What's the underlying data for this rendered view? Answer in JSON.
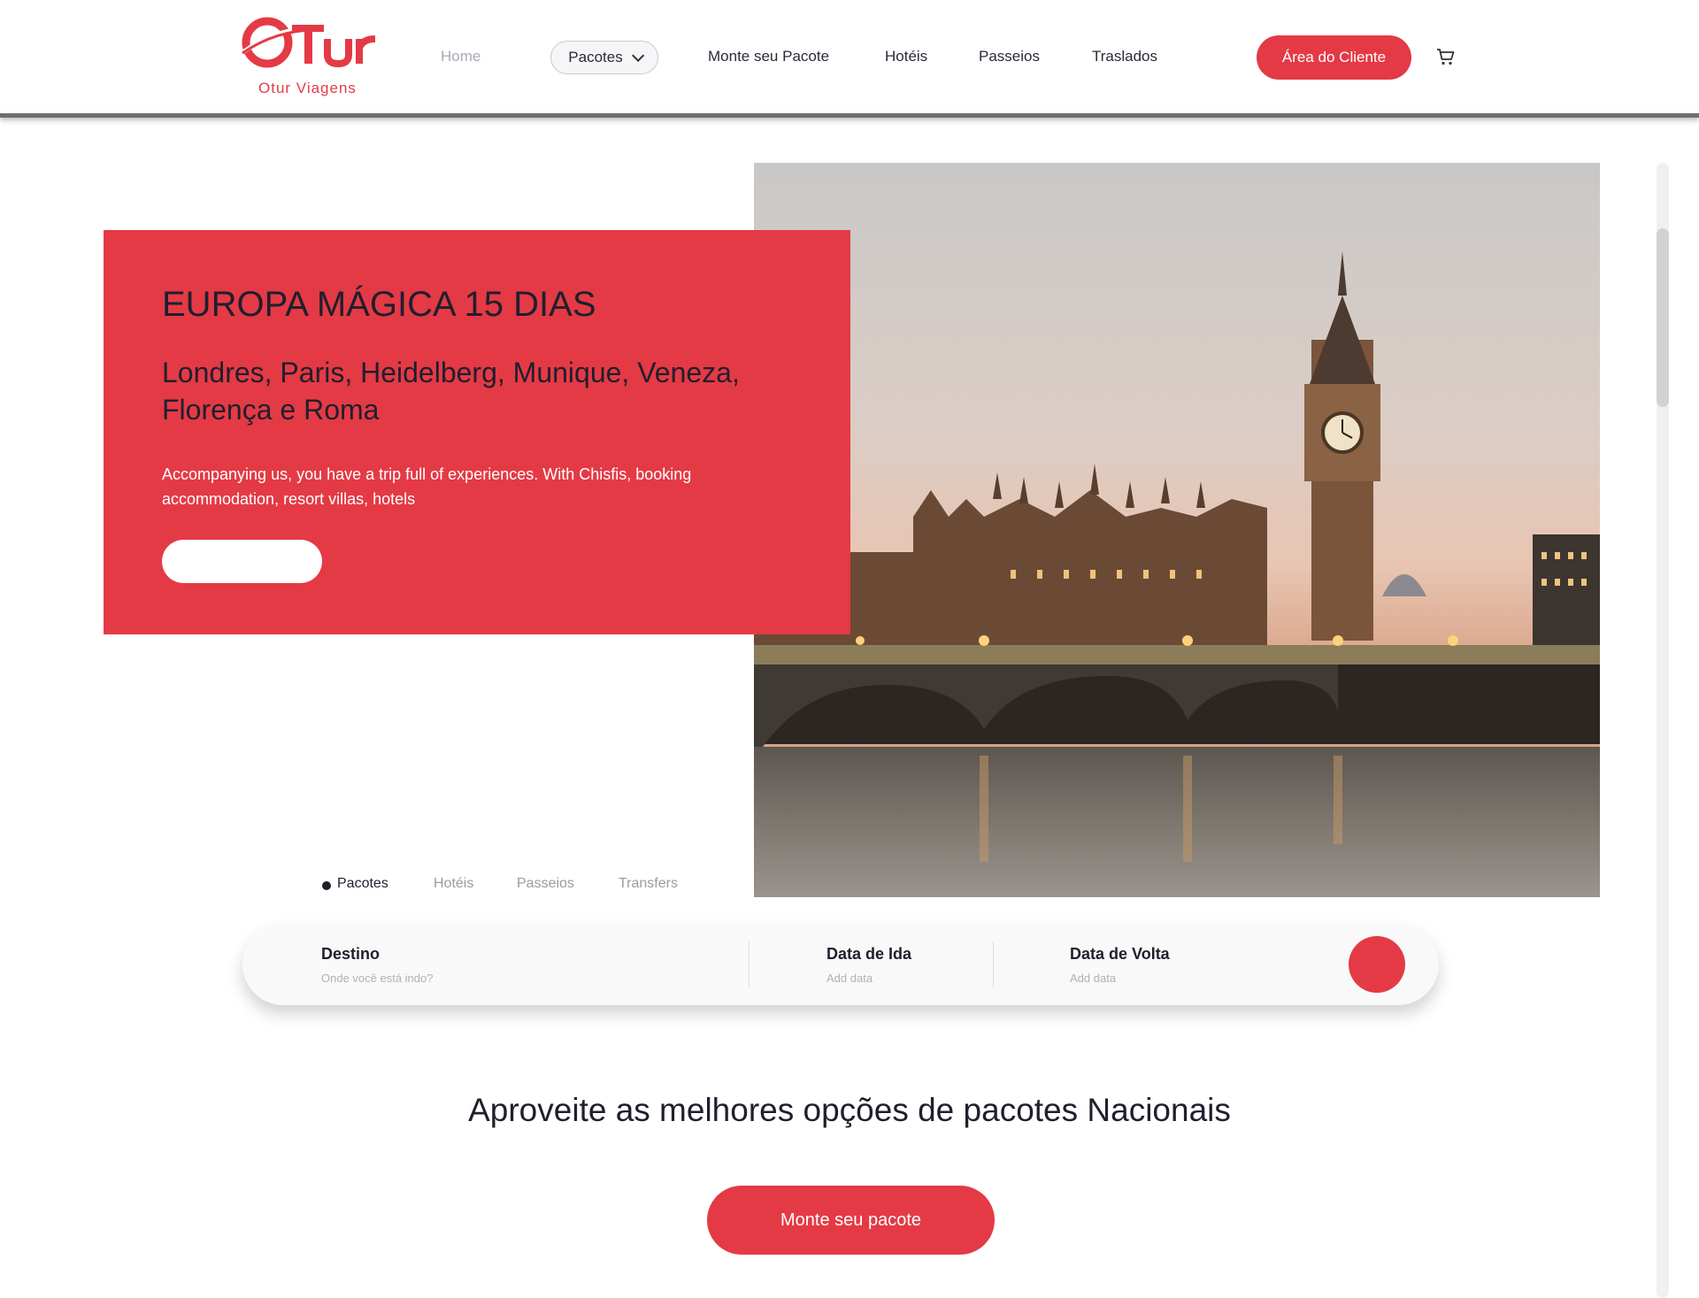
{
  "brand": {
    "logo_text": "Otur",
    "subtitle": "Otur Viagens"
  },
  "nav": {
    "home": "Home",
    "pacotes": "Pacotes",
    "monte": "Monte seu Pacote",
    "hoteis": "Hotéis",
    "passeios": "Passeios",
    "traslados": "Traslados",
    "cliente_button": "Área do Cliente"
  },
  "hero": {
    "title": "EUROPA MÁGICA 15 DIAS",
    "subtitle": "Londres, Paris, Heidelberg, Munique, Veneza, Florença e Roma",
    "description": "Accompanying us, you have a trip full of experiences. With Chisfis, booking accommodation, resort villas, hotels",
    "button_label": ""
  },
  "tabs": [
    {
      "label": "Pacotes",
      "active": true
    },
    {
      "label": "Hotéis",
      "active": false
    },
    {
      "label": "Passeios",
      "active": false
    },
    {
      "label": "Transfers",
      "active": false
    }
  ],
  "search": {
    "destino_label": "Destino",
    "destino_placeholder": "Onde você está indo?",
    "ida_label": "Data de Ida",
    "ida_placeholder": "Add data",
    "volta_label": "Data de Volta",
    "volta_placeholder": "Add data"
  },
  "section": {
    "title": "Aproveite as melhores opções de pacotes Nacionais",
    "cta": "Monte seu pacote"
  },
  "colors": {
    "accent": "#e43a45",
    "text_dark": "#1f1f2e",
    "muted": "#a9a9b3"
  }
}
